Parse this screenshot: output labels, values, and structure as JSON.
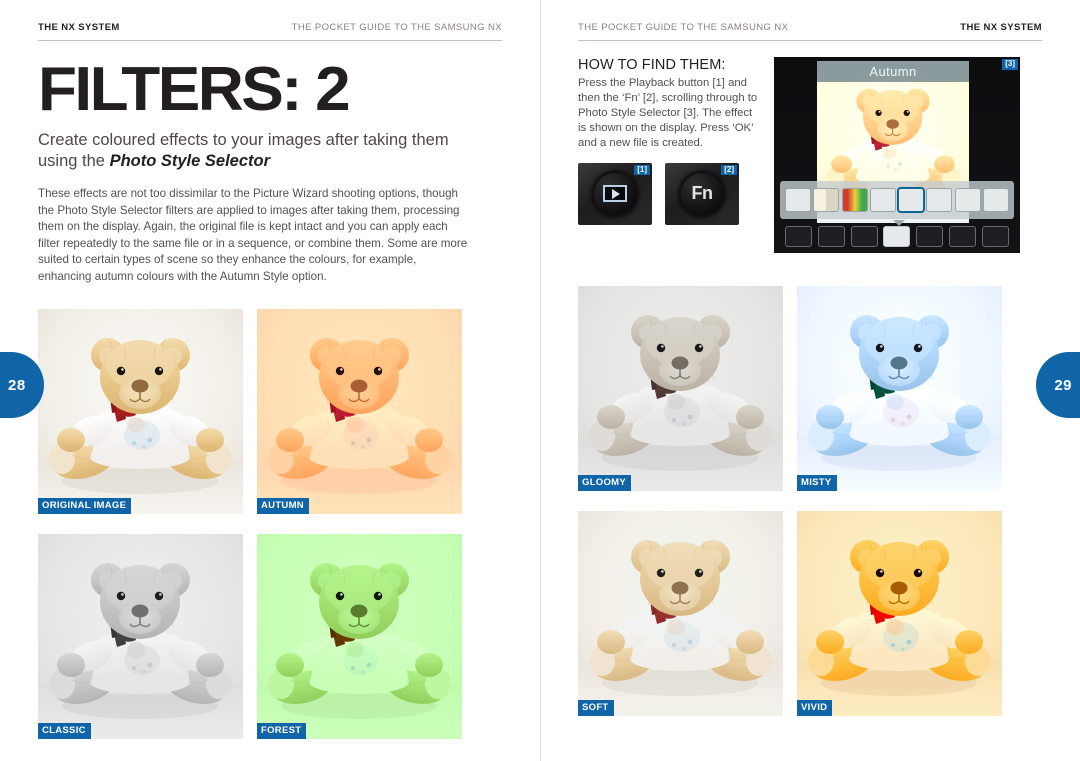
{
  "publication": {
    "running_head_title": "THE POCKET GUIDE TO THE SAMSUNG NX",
    "section_name": "THE NX SYSTEM",
    "accent_color": "#1065a8",
    "rule_color": "#cbbfbd",
    "text_color": "#231f20"
  },
  "left_page": {
    "page_number": "28",
    "header": {
      "left": "THE NX SYSTEM",
      "right": "THE POCKET GUIDE TO THE SAMSUNG NX"
    },
    "headline": "FILTERS: 2",
    "standfirst_lead": "Create coloured effects to your images after taking them using the ",
    "standfirst_emphasis": "Photo Style Selector",
    "body_copy": "These effects are not too dissimilar to the Picture Wizard shooting options, though the Photo Style Selector filters are applied to images after taking them, processing them on the display. Again, the original file is kept intact and you can apply each filter repeatedly to the same file or in a sequence, or combine them.  Some are more suited to certain types of scene so they enhance the colours, for example, enhancing autumn colours with the Autumn Style option.",
    "gallery": [
      {
        "label": "ORIGINAL IMAGE",
        "filter": "f-original",
        "bg": "#f2efe9",
        "tint": ""
      },
      {
        "label": "AUTUMN",
        "filter": "f-autumn",
        "bg": "#f6c9a0",
        "tint": "rgba(244,182,128,0.45)"
      },
      {
        "label": "CLASSIC",
        "filter": "f-classic",
        "bg": "#d6d6d6",
        "tint": "rgba(190,190,190,0.35)"
      },
      {
        "label": "FOREST",
        "filter": "f-forest",
        "bg": "#a9dc97",
        "tint": "rgba(150,212,128,0.50)"
      }
    ]
  },
  "right_page": {
    "page_number": "29",
    "header": {
      "left": "THE POCKET GUIDE TO THE SAMSUNG NX",
      "right": "THE NX SYSTEM"
    },
    "howto": {
      "heading": "HOW TO FIND THEM:",
      "body": "Press the Playback button [1] and then the ‘Fn’ [2], scrolling through to Photo Style Selector [3]. The effect is shown on the display. Press ‘OK’ and a new file is created."
    },
    "buttons": [
      {
        "callout": "[1]",
        "glyph": "playback-icon",
        "label": ""
      },
      {
        "callout": "[2]",
        "glyph": "fn-icon",
        "label": "Fn"
      }
    ],
    "lcd": {
      "callout": "[3]",
      "title": "Autumn",
      "style_icons": [
        {
          "name": "style-icon-normal",
          "selected": false,
          "variant": "plain"
        },
        {
          "name": "style-icon-vignette",
          "selected": false,
          "variant": "c1"
        },
        {
          "name": "style-icon-colour",
          "selected": false,
          "variant": "c2"
        },
        {
          "name": "style-icon-sketch",
          "selected": false,
          "variant": "plain"
        },
        {
          "name": "style-icon-autumn",
          "selected": true,
          "variant": "plain"
        },
        {
          "name": "style-icon-soft",
          "selected": false,
          "variant": "plain"
        },
        {
          "name": "style-icon-misty",
          "selected": false,
          "variant": "plain"
        },
        {
          "name": "style-icon-frame",
          "selected": false,
          "variant": "plain"
        }
      ],
      "status_icons": [
        {
          "name": "red-eye-icon",
          "state": "OFF",
          "highlight": false
        },
        {
          "name": "backlight-icon",
          "state": "OFF",
          "highlight": false
        },
        {
          "name": "face-retouch-icon",
          "state": "OFF",
          "highlight": false
        },
        {
          "name": "photo-style-icon",
          "state": "ON",
          "highlight": true
        },
        {
          "name": "resize-icon",
          "state": "OFF",
          "highlight": false
        },
        {
          "name": "rotate-icon",
          "state": "OFF",
          "highlight": false
        },
        {
          "name": "trim-icon",
          "state": "OFF",
          "highlight": false
        }
      ]
    },
    "gallery": [
      {
        "label": "GLOOMY",
        "filter": "f-gloomy",
        "bg": "#d3d3d2",
        "tint": "rgba(196,196,196,0.30)"
      },
      {
        "label": "MISTY",
        "filter": "f-misty",
        "bg": "#b5dbe7",
        "tint": "rgba(160,208,224,0.45)"
      },
      {
        "label": "SOFT",
        "filter": "f-soft",
        "bg": "#efeae1",
        "tint": "rgba(236,228,214,0.25)"
      },
      {
        "label": "VIVID",
        "filter": "f-vivid",
        "bg": "#f4dcb2",
        "tint": "rgba(240,214,160,0.35)"
      }
    ]
  },
  "subject": {
    "description": "teddy bear wearing white t-shirt with red ribbon",
    "fur_color": "#e8c98e",
    "shirt_color": "#fbfbfa",
    "ribbon_color": "#a81f20"
  }
}
